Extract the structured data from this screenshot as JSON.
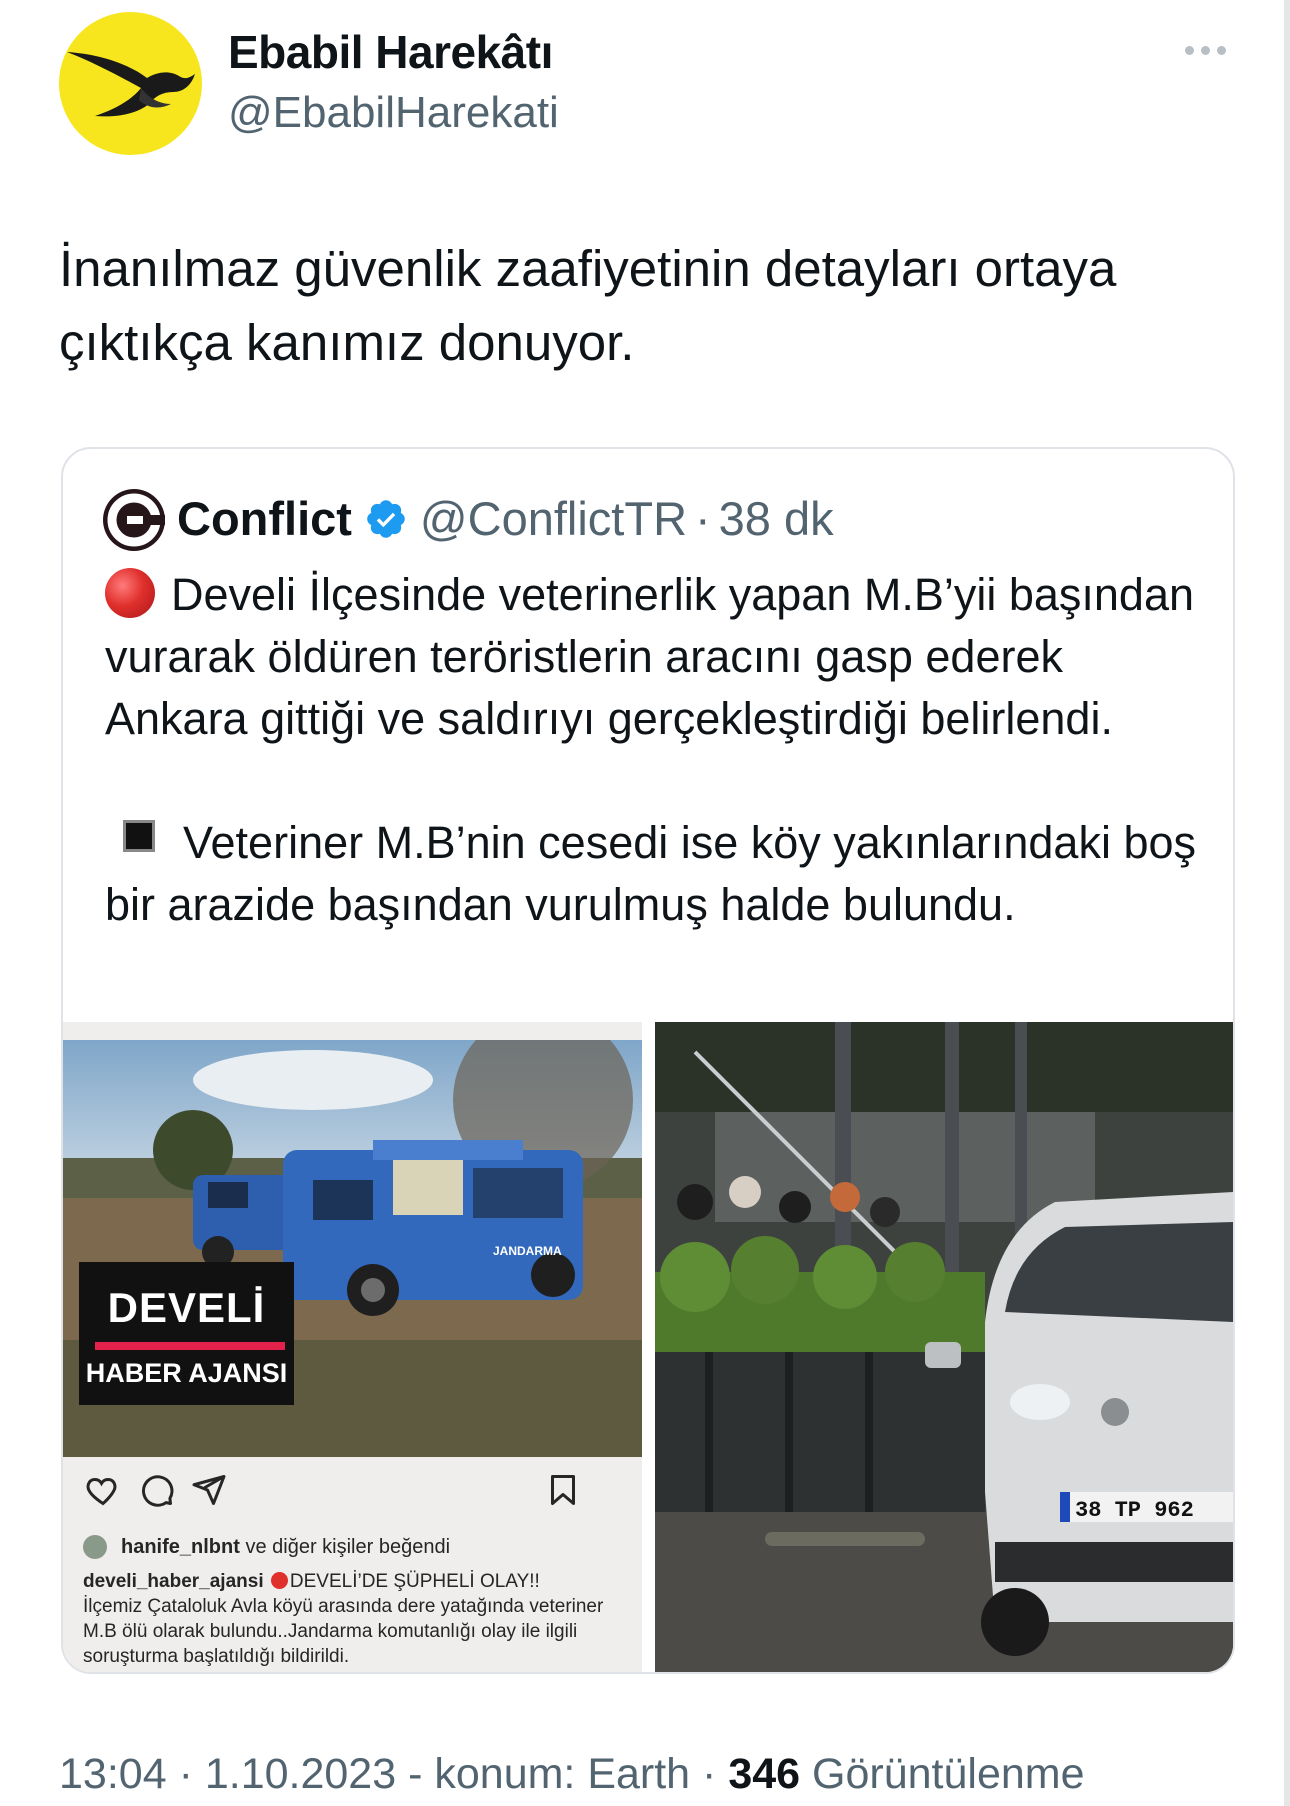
{
  "author": {
    "name": "Ebabil Harekâtı",
    "handle": "@EbabilHarekati"
  },
  "tweet": {
    "text": "İnanılmaz güvenlik zaafiyetinin detayları ortaya çıktıkça kanımız donuyor."
  },
  "quoted": {
    "name": "Conflict",
    "handle": "@ConflictTR",
    "separator": "·",
    "time": "38 dk",
    "para1": "Develi İlçesinde veterinerlik yapan M.B’yii başından vurarak öldüren teröristlerin aracını gasp ederek Ankara gittiği ve saldırıyı gerçekleştirdiği belirlendi.",
    "para2": "Veteriner M.B’nin cesedi ise köy yakınlarındaki boş bir arazide başından vurulmuş halde bulundu.",
    "media_left": {
      "logo_line1": "DEVELİ",
      "logo_line2": "HABER AJANSI",
      "vehicle_text": "JANDARMA",
      "likes_user": "hanife_nlbnt",
      "likes_suffix": "ve diğer kişiler beğendi",
      "caption_user": "develi_haber_ajansi",
      "caption_headline": "DEVELİ’DE ŞÜPHELİ OLAY!!",
      "caption_body": "İlçemiz Çataloluk Avla köyü arasında dere yatağında veteriner M.B ölü olarak bulundu..Jandarma komutanlığı olay ile ilgili soruşturma başlatıldığı bildirildi."
    },
    "media_right": {
      "plate": "38 TP 962"
    }
  },
  "footer": {
    "time": "13:04",
    "sep1": "·",
    "date": "1.10.2023",
    "location": "- konum: Earth",
    "sep2": "·",
    "views": "346",
    "views_label": "Görüntülenme"
  },
  "colors": {
    "avatar_bg": "#f7e61d",
    "secondary_text": "#536471",
    "verified": "#1d9bf0",
    "border": "#dfe3e7"
  },
  "icons": [
    "swallow-bird-icon",
    "more-icon",
    "verified-badge-icon",
    "red-circle-icon",
    "black-square-icon",
    "heart-icon",
    "comment-icon",
    "share-icon",
    "bookmark-icon"
  ]
}
